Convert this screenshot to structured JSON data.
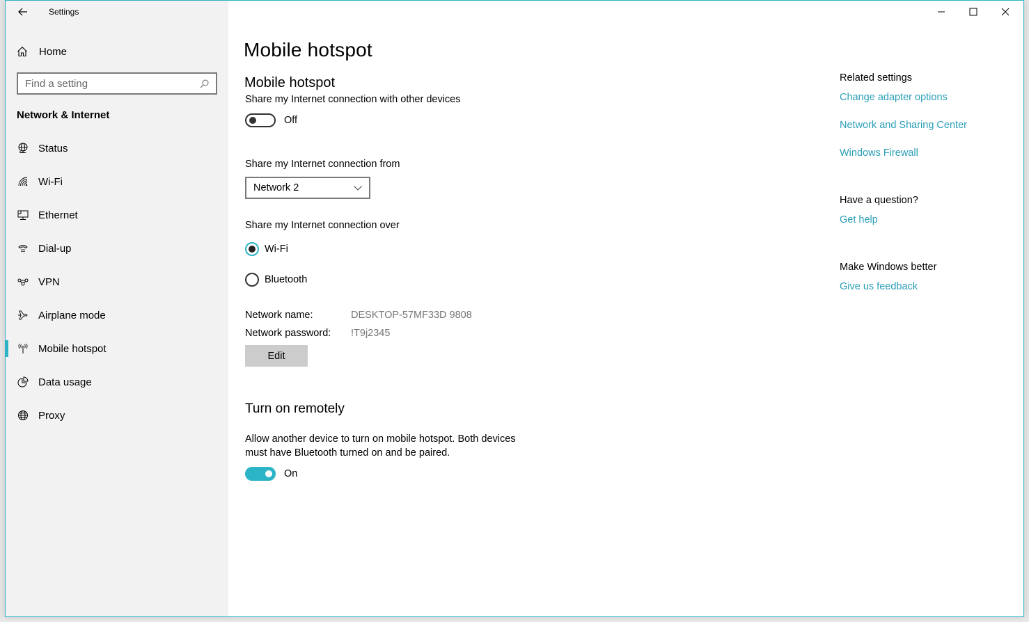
{
  "window": {
    "title": "Settings",
    "controls": {
      "minimize": "minimize-icon",
      "maximize": "maximize-icon",
      "close": "close-icon"
    },
    "accent_color": "#2bb3c6",
    "link_color": "#2a9fb7"
  },
  "sidebar": {
    "home_label": "Home",
    "search_placeholder": "Find a setting",
    "section_title": "Network & Internet",
    "items": [
      {
        "label": "Status",
        "icon": "status-globe-icon",
        "active": false
      },
      {
        "label": "Wi-Fi",
        "icon": "wifi-icon",
        "active": false
      },
      {
        "label": "Ethernet",
        "icon": "ethernet-icon",
        "active": false
      },
      {
        "label": "Dial-up",
        "icon": "dialup-phone-icon",
        "active": false
      },
      {
        "label": "VPN",
        "icon": "vpn-icon",
        "active": false
      },
      {
        "label": "Airplane mode",
        "icon": "airplane-icon",
        "active": false
      },
      {
        "label": "Mobile hotspot",
        "icon": "hotspot-icon",
        "active": true
      },
      {
        "label": "Data usage",
        "icon": "data-usage-icon",
        "active": false
      },
      {
        "label": "Proxy",
        "icon": "proxy-globe-icon",
        "active": false
      }
    ]
  },
  "main": {
    "page_title": "Mobile hotspot",
    "hotspot": {
      "heading": "Mobile hotspot",
      "description": "Share my Internet connection with other devices",
      "toggle_state": "Off",
      "toggle_on": false
    },
    "share_from": {
      "label": "Share my Internet connection from",
      "selected": "Network 2"
    },
    "share_over": {
      "label": "Share my Internet connection over",
      "options": [
        {
          "label": "Wi-Fi",
          "selected": true
        },
        {
          "label": "Bluetooth",
          "selected": false
        }
      ]
    },
    "network": {
      "name_label": "Network name:",
      "name_value": "DESKTOP-57MF33D 9808",
      "password_label": "Network password:",
      "password_value": "!T9j2345",
      "edit_label": "Edit"
    },
    "remote": {
      "heading": "Turn on remotely",
      "description_line1": "Allow another device to turn on mobile hotspot. Both devices",
      "description_line2": "must have Bluetooth turned on and be paired.",
      "toggle_state": "On",
      "toggle_on": true
    }
  },
  "right_panel": {
    "related_header": "Related settings",
    "related_links": [
      "Change adapter options",
      "Network and Sharing Center",
      "Windows Firewall"
    ],
    "question_header": "Have a question?",
    "question_link": "Get help",
    "better_header": "Make Windows better",
    "better_link": "Give us feedback"
  }
}
